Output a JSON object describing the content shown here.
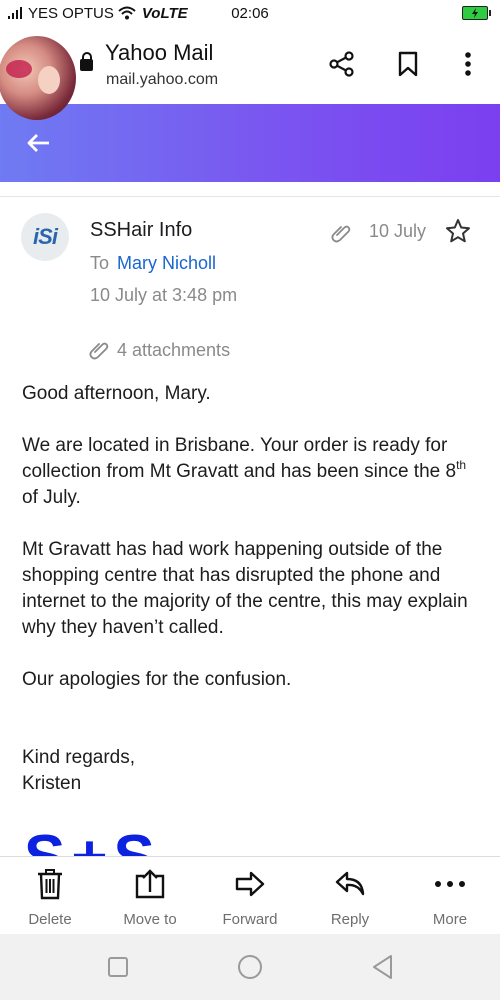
{
  "status_bar": {
    "carrier": "YES OPTUS",
    "volte": "VoLTE",
    "time": "02:06"
  },
  "header": {
    "title": "Yahoo Mail",
    "url": "mail.yahoo.com"
  },
  "colors": {
    "accent": "#7b4ff0",
    "link": "#1a66d0",
    "signature": "#0d22e0"
  },
  "email": {
    "sender": "SSHair Info",
    "sender_logo_text": "iSi",
    "to_label": "To",
    "to_name": "Mary Nicholl",
    "sent_at": "10 July at 3:48 pm",
    "short_date": "10 July",
    "attachments_label": "4 attachments",
    "body": {
      "greeting": "Good afternoon, Mary.",
      "p1_before_sup": "We are located in Brisbane. Your order is ready for collection from Mt Gravatt and has been since the 8",
      "p1_sup": "th",
      "p1_after_sup": " of July.",
      "p2": "Mt Gravatt has had work happening outside of the shopping centre that has disrupted the phone and internet to the majority of the centre, this may explain why they haven’t called.",
      "p3": "Our apologies for the confusion.",
      "closing": "Kind regards,",
      "signature_name": "Kristen",
      "signature_logo": "S+S"
    }
  },
  "toolbar": {
    "delete": "Delete",
    "move_to": "Move to",
    "forward": "Forward",
    "reply": "Reply",
    "more": "More"
  },
  "icons": [
    "share-icon",
    "bookmark-icon",
    "more-vert-icon",
    "back-arrow-icon",
    "paperclip-icon",
    "star-icon",
    "trash-icon",
    "move-to-icon",
    "forward-icon",
    "reply-icon",
    "more-horiz-icon"
  ]
}
